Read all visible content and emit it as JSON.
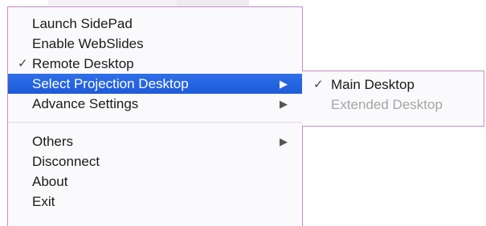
{
  "main_menu": {
    "items": [
      {
        "label": "Launch SidePad",
        "checked": false,
        "submenu": false
      },
      {
        "label": "Enable WebSlides",
        "checked": false,
        "submenu": false
      },
      {
        "label": "Remote Desktop",
        "checked": true,
        "submenu": false
      },
      {
        "label": "Select Projection Desktop",
        "checked": false,
        "submenu": true,
        "highlighted": true
      },
      {
        "label": "Advance Settings",
        "checked": false,
        "submenu": true
      },
      {
        "label": "Others",
        "checked": false,
        "submenu": true
      },
      {
        "label": "Disconnect",
        "checked": false,
        "submenu": false
      },
      {
        "label": "About",
        "checked": false,
        "submenu": false
      },
      {
        "label": "Exit",
        "checked": false,
        "submenu": false
      }
    ]
  },
  "sub_menu": {
    "items": [
      {
        "label": "Main Desktop",
        "checked": true,
        "enabled": true
      },
      {
        "label": "Extended Desktop",
        "checked": false,
        "enabled": false
      }
    ]
  },
  "icons": {
    "check": "✓",
    "submenu_arrow": "▶"
  },
  "colors": {
    "highlight": "#2563e0",
    "menu_border": "#c78cc7",
    "disabled_text": "#a6a6a6"
  }
}
